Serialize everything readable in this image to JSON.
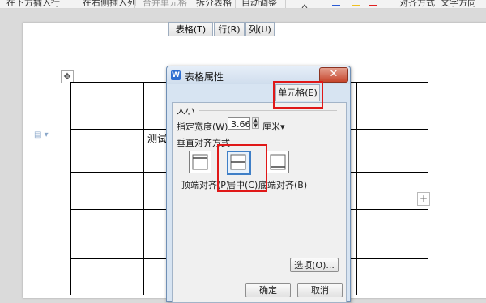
{
  "toolbar": {
    "items": [
      "在下方插入行",
      "在右侧插入列",
      "合并单元格",
      "拆分表格",
      "自动调整",
      "对齐方式",
      "文字方向"
    ]
  },
  "document": {
    "cell_text": "测试"
  },
  "dialog": {
    "title": "表格属性",
    "app_icon_letter": "W",
    "close_symbol": "✕",
    "tabs": [
      {
        "label": "表格(T)"
      },
      {
        "label": "行(R)"
      },
      {
        "label": "列(U)"
      },
      {
        "label": "单元格(E)",
        "active": true
      }
    ],
    "size_group_label": "大小",
    "width_label": "指定宽度(W):",
    "width_value": "3.66",
    "width_unit": "厘米",
    "valign_group_label": "垂直对齐方式",
    "valign_options": [
      {
        "label": "顶端对齐(P)",
        "icon": "align-top-icon"
      },
      {
        "label": "居中(C)",
        "icon": "align-middle-icon",
        "selected": true
      },
      {
        "label": "底端对齐(B)",
        "icon": "align-bottom-icon"
      }
    ],
    "options_button": "选项(O)...",
    "ok_button": "确定",
    "cancel_button": "取消"
  },
  "colors": {
    "highlight": "#e01818",
    "accent": "#3f7fc7"
  }
}
